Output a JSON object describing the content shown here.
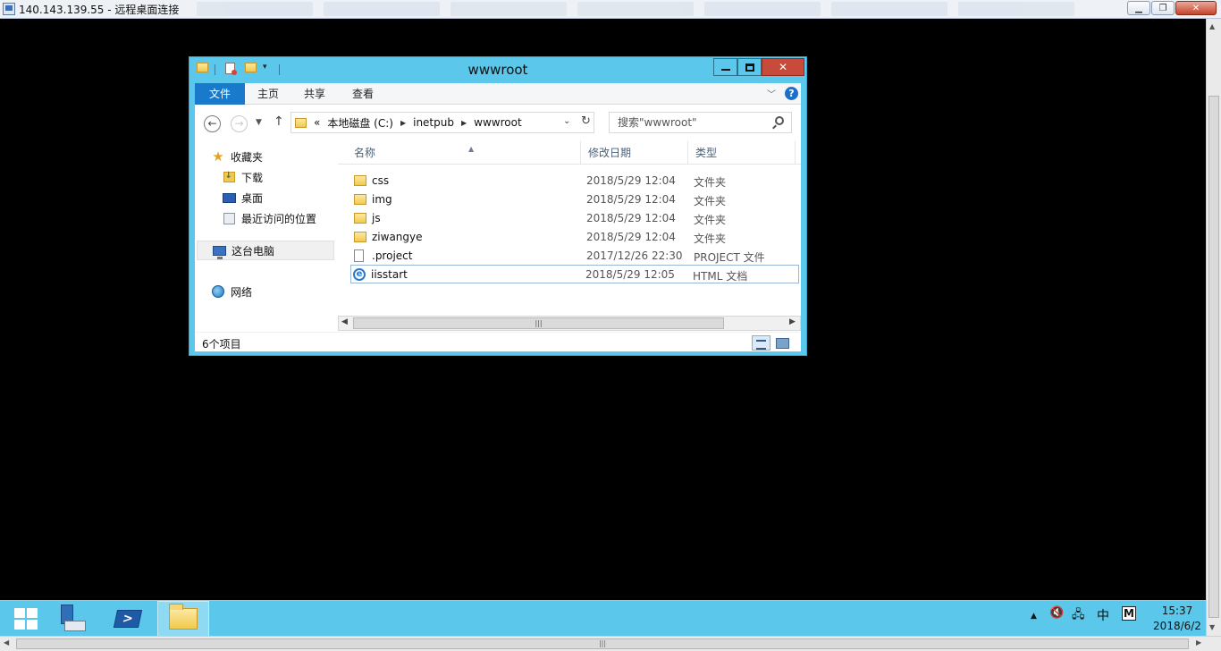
{
  "rdp": {
    "title": "140.143.139.55 - 远程桌面连接",
    "icons": [
      "rdp-icon",
      "minimize-icon",
      "restore-icon",
      "close-icon"
    ]
  },
  "explorer": {
    "title": "wwwroot",
    "ribbon_tabs": [
      "文件",
      "主页",
      "共享",
      "查看"
    ],
    "breadcrumb": {
      "overflow": "«",
      "parts": [
        "本地磁盘 (C:)",
        "inetpub",
        "wwwroot"
      ]
    },
    "search_placeholder": "搜索\"wwwroot\"",
    "nav": {
      "favorites": "收藏夹",
      "downloads": "下载",
      "desktop": "桌面",
      "recent": "最近访问的位置",
      "this_pc": "这台电脑",
      "network": "网络"
    },
    "columns": {
      "name": "名称",
      "date": "修改日期",
      "type": "类型"
    },
    "files": [
      {
        "icon": "folder-icon",
        "name": "css",
        "date": "2018/5/29 12:04",
        "type": "文件夹"
      },
      {
        "icon": "folder-icon",
        "name": "img",
        "date": "2018/5/29 12:04",
        "type": "文件夹"
      },
      {
        "icon": "folder-icon",
        "name": "js",
        "date": "2018/5/29 12:04",
        "type": "文件夹"
      },
      {
        "icon": "folder-icon",
        "name": "ziwangye",
        "date": "2018/5/29 12:04",
        "type": "文件夹"
      },
      {
        "icon": "file-icon",
        "name": ".project",
        "date": "2017/12/26 22:30",
        "type": "PROJECT 文件"
      },
      {
        "icon": "ie-html-icon",
        "name": "iisstart",
        "date": "2018/5/29 12:05",
        "type": "HTML 文档"
      }
    ],
    "selected_row": 5,
    "status_count": "6个项目"
  },
  "taskbar": {
    "time": "15:37",
    "date": "2018/6/2",
    "ime": "中",
    "m_label": "M",
    "colors": {
      "taskbar": "#5bc7ea",
      "ribbon_file_tab": "#1979ca",
      "close_button": "#c74a3a"
    }
  }
}
